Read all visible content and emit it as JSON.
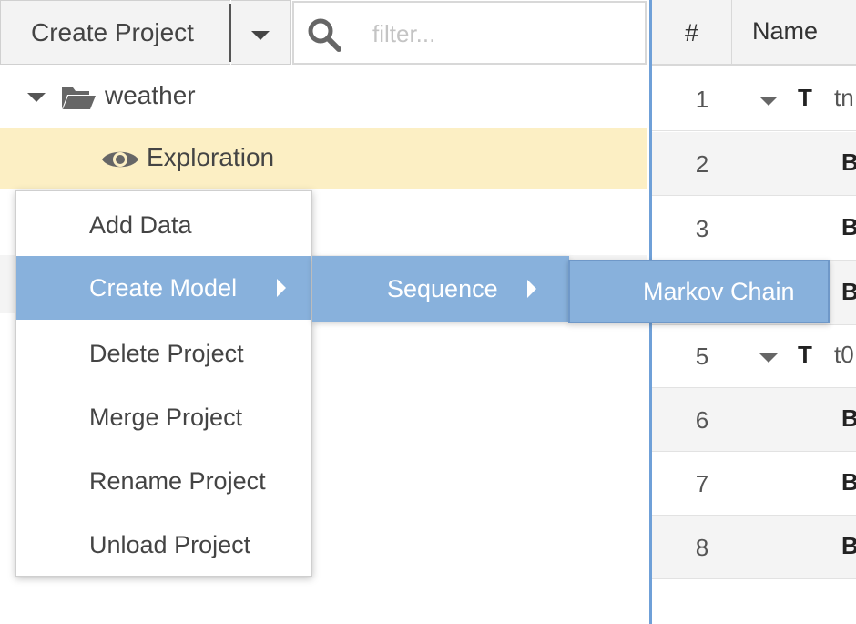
{
  "toolbar": {
    "create_label": "Create Project",
    "filter_placeholder": "filter..."
  },
  "tree": {
    "project": "weather",
    "view": "Exploration"
  },
  "table": {
    "headers": {
      "index": "#",
      "name": "Name"
    },
    "rows": [
      {
        "num": "1",
        "type": "T",
        "name": "tn",
        "group": true
      },
      {
        "num": "2",
        "type": "B"
      },
      {
        "num": "3",
        "type": "B"
      },
      {
        "num": "4",
        "type": "B"
      },
      {
        "num": "5",
        "type": "T",
        "name": "t0",
        "group": true
      },
      {
        "num": "6",
        "type": "B"
      },
      {
        "num": "7",
        "type": "B"
      },
      {
        "num": "8",
        "type": "B"
      }
    ]
  },
  "context_menu": {
    "items": [
      "Add Data",
      "Create Model",
      "Delete Project",
      "Merge Project",
      "Rename Project",
      "Unload Project"
    ],
    "submenu": "Sequence",
    "submenu2": "Markov Chain"
  },
  "colors": {
    "accent": "#88b1dc",
    "selection": "#fcefc4",
    "divider": "#6fa0d8"
  }
}
